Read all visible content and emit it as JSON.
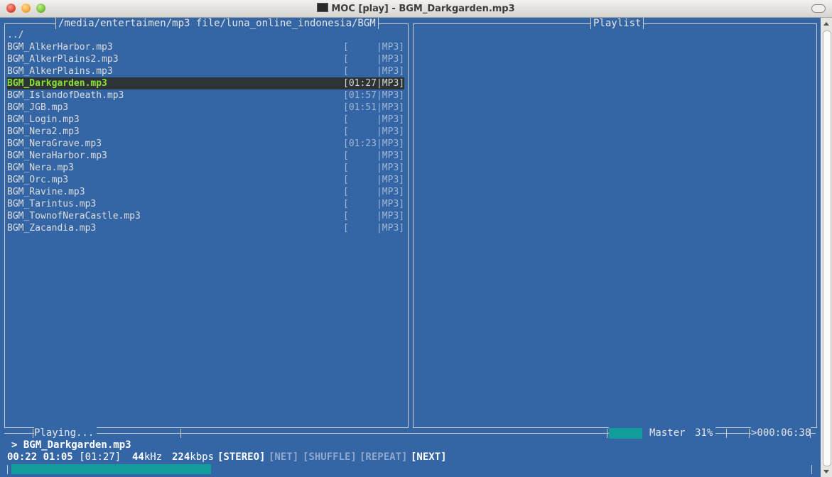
{
  "window": {
    "title": "MOC [play] - BGM_Darkgarden.mp3"
  },
  "colors": {
    "terminal_bg": "#3465a4",
    "selected_text": "#8ae234",
    "progress": "#129c9c"
  },
  "file_panel": {
    "path": "/media/entertaimen/mp3 file/luna_online_indonesia/BGM",
    "parent": "../",
    "files": [
      {
        "name": "BGM_AlkerHarbor.mp3",
        "time": "[     |MP3]"
      },
      {
        "name": "BGM_AlkerPlains2.mp3",
        "time": "[     |MP3]"
      },
      {
        "name": "BGM_AlkerPlains.mp3",
        "time": "[     |MP3]"
      },
      {
        "name": "BGM_Darkgarden.mp3",
        "time": "[01:27|MP3]"
      },
      {
        "name": "BGM_IslandofDeath.mp3",
        "time": "[01:57|MP3]"
      },
      {
        "name": "BGM_JGB.mp3",
        "time": "[01:51|MP3]"
      },
      {
        "name": "BGM_Login.mp3",
        "time": "[     |MP3]"
      },
      {
        "name": "BGM_Nera2.mp3",
        "time": "[     |MP3]"
      },
      {
        "name": "BGM_NeraGrave.mp3",
        "time": "[01:23|MP3]"
      },
      {
        "name": "BGM_NeraHarbor.mp3",
        "time": "[     |MP3]"
      },
      {
        "name": "BGM_Nera.mp3",
        "time": "[     |MP3]"
      },
      {
        "name": "BGM_Orc.mp3",
        "time": "[     |MP3]"
      },
      {
        "name": "BGM_Ravine.mp3",
        "time": "[     |MP3]"
      },
      {
        "name": "BGM_Tarintus.mp3",
        "time": "[     |MP3]"
      },
      {
        "name": "BGM_TownofNeraCastle.mp3",
        "time": "[     |MP3]"
      },
      {
        "name": "BGM_Zacandia.mp3",
        "time": "[     |MP3]"
      }
    ]
  },
  "playlist_panel": {
    "title": "Playlist"
  },
  "player": {
    "state": "Playing...",
    "volume_label": "Master",
    "volume": "31%",
    "volume_fraction": 0.31,
    "total_time": ">000:06:38",
    "now_playing": "> BGM_Darkgarden.mp3",
    "elapsed": "00:22",
    "remaining": "01:05",
    "duration": "[01:27]",
    "rate_value": "44",
    "rate_unit": "kHz",
    "bitrate_value": "224",
    "bitrate_unit": "kbps",
    "flags": {
      "stereo": "[STEREO]",
      "net": "[NET]",
      "shuffle": "[SHUFFLE]",
      "repeat": "[REPEAT]",
      "next": "[NEXT]"
    },
    "progress_fraction": 0.25
  }
}
